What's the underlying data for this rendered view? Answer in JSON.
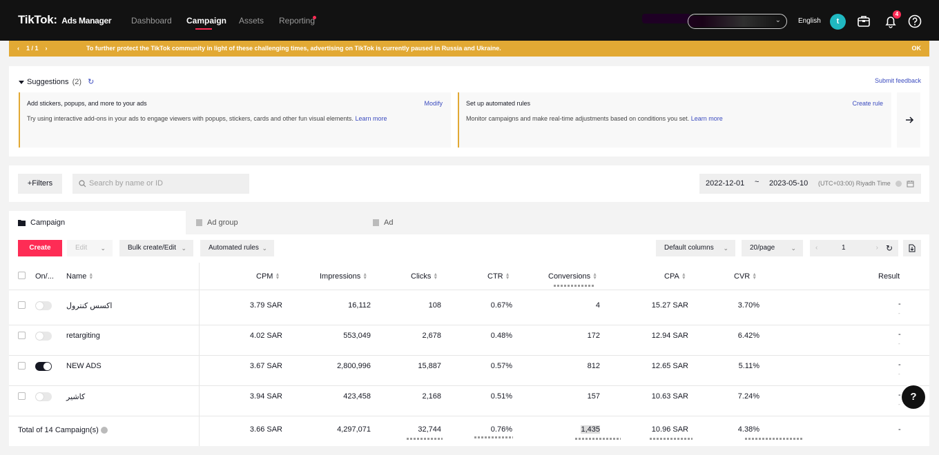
{
  "nav": {
    "logo": "TikTok",
    "logo_sep": ":",
    "product": "Ads Manager",
    "links": [
      "Dashboard",
      "Campaign",
      "Assets",
      "Reporting"
    ],
    "active_link": "Campaign",
    "language": "English",
    "avatar_initial": "t",
    "notification_count": "4"
  },
  "notice": {
    "pager": "1  /  1",
    "message": "To further protect the TikTok community in light of these challenging times, advertising on TikTok is currently paused in Russia and Ukraine.",
    "ok": "OK"
  },
  "suggestions": {
    "title": "Suggestions",
    "count": "(2)",
    "submit_feedback": "Submit feedback",
    "cards": [
      {
        "title": "Add stickers, popups, and more to your ads",
        "desc": "Try using interactive add-ons in your ads to engage viewers with popups, stickers, cards and other fun visual elements.",
        "learn_more": "Learn more",
        "action": "Modify"
      },
      {
        "title": "Set up automated rules",
        "desc": "Monitor campaigns and make real-time adjustments based on conditions you set.",
        "learn_more": "Learn more",
        "action": "Create rule"
      }
    ]
  },
  "filters": {
    "filters_label": "Filters",
    "search_placeholder": "Search by name or ID",
    "date_start": "2022-12-01",
    "date_sep": "~",
    "date_end": "2023-05-10",
    "timezone": "(UTC+03:00) Riyadh Time"
  },
  "tabs": [
    "Campaign",
    "Ad group",
    "Ad"
  ],
  "toolbar": {
    "create": "Create",
    "edit": "Edit",
    "bulk": "Bulk create/Edit",
    "automated": "Automated rules",
    "columns": "Default columns",
    "per_page": "20/page",
    "page": "1"
  },
  "table": {
    "headers": {
      "onoff": "On/...",
      "name": "Name",
      "cpm": "CPM",
      "impressions": "Impressions",
      "clicks": "Clicks",
      "ctr": "CTR",
      "conversions": "Conversions",
      "cpa": "CPA",
      "cvr": "CVR",
      "result": "Result"
    },
    "rows": [
      {
        "name": "اكسس كنترول",
        "on": false,
        "cpm": "3.79 SAR",
        "impressions": "16,112",
        "clicks": "108",
        "ctr": "0.67%",
        "conversions": "4",
        "cpa": "15.27 SAR",
        "cvr": "3.70%",
        "result": "-"
      },
      {
        "name": "retargiting",
        "on": false,
        "cpm": "4.02 SAR",
        "impressions": "553,049",
        "clicks": "2,678",
        "ctr": "0.48%",
        "conversions": "172",
        "cpa": "12.94 SAR",
        "cvr": "6.42%",
        "result": "-"
      },
      {
        "name": "NEW ADS",
        "on": true,
        "cpm": "3.67 SAR",
        "impressions": "2,800,996",
        "clicks": "15,887",
        "ctr": "0.57%",
        "conversions": "812",
        "cpa": "12.65 SAR",
        "cvr": "5.11%",
        "result": "-"
      },
      {
        "name": "كاشير",
        "on": false,
        "cpm": "3.94 SAR",
        "impressions": "423,458",
        "clicks": "2,168",
        "ctr": "0.51%",
        "conversions": "157",
        "cpa": "10.63 SAR",
        "cvr": "7.24%",
        "result": "-"
      }
    ],
    "total": {
      "label": "Total of 14 Campaign(s)",
      "cpm": "3.66 SAR",
      "impressions": "4,297,071",
      "clicks": "32,744",
      "ctr": "0.76%",
      "conversions": "1,435",
      "cpa": "10.96 SAR",
      "cvr": "4.38%",
      "result": "-"
    }
  },
  "help_fab": "?"
}
